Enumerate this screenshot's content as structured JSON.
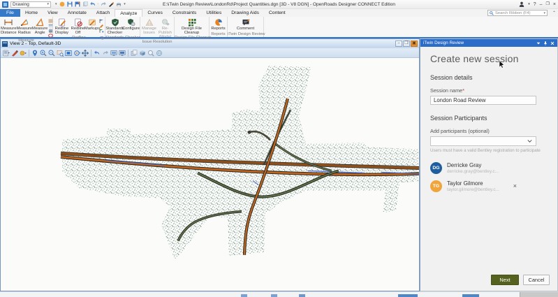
{
  "titlebar": {
    "workflow_label": "Drawing",
    "document_title": "E:\\iTwin Design Review\\LondonRd\\Project Quantities.dgn [3D - V8 DGN] - OpenRoads Designer CONNECT Edition",
    "search_placeholder": "Search Ribbon (F4)"
  },
  "tabs": {
    "file": "File",
    "items": [
      "Home",
      "View",
      "Annotate",
      "Attach",
      "Analyze",
      "Curves",
      "Constraints",
      "Utilities",
      "Drawing Aids",
      "Content"
    ],
    "active": "Analyze"
  },
  "ribbon": {
    "groups": [
      {
        "label": "Measure",
        "buttons": [
          {
            "label": "Measure Distance"
          },
          {
            "label": "Measure Radius"
          },
          {
            "label": "Measure Angle"
          }
        ]
      },
      {
        "label": "Redline",
        "buttons": [
          {
            "label": "Redline Display"
          },
          {
            "label": "Redline Off"
          },
          {
            "label": "Markups"
          }
        ]
      },
      {
        "label": "Standards Checker",
        "buttons": [
          {
            "label": "Standards Checker"
          },
          {
            "label": "Configure"
          }
        ]
      },
      {
        "label": "Issue Resolution",
        "buttons": [
          {
            "label": "Manage Issues"
          },
          {
            "label": "Re-Publish iModel"
          }
        ]
      },
      {
        "label": "Design File Cleanup",
        "buttons": [
          {
            "label": "Design File Cleanup"
          }
        ]
      },
      {
        "label": "Reports",
        "buttons": [
          {
            "label": "Reports"
          }
        ]
      },
      {
        "label": "iTwin Design Review",
        "buttons": [
          {
            "label": "Comment"
          }
        ]
      }
    ]
  },
  "view": {
    "title": "View 2 - Top, Default-3D"
  },
  "panel": {
    "title": "iTwin Design Review",
    "heading": "Create new session",
    "session_details": "Session details",
    "session_name_label": "Session name",
    "required_marker": "*",
    "session_name_value": "London Road Review",
    "participants_heading": "Session Participants",
    "add_participants_label": "Add participants (optional)",
    "helper_text": "Users must have a valid Bentley registration to participate",
    "participants": [
      {
        "initials": "DG",
        "name": "Derricke Gray",
        "email": "derricke.gray@bentley.c...",
        "color": "#1f5e9e"
      },
      {
        "initials": "TG",
        "name": "Taylor Gilmore",
        "email": "taylor.gilmore@bentley.c...",
        "color": "#f0a43c"
      }
    ],
    "remove_label": "×",
    "next_label": "Next",
    "cancel_label": "Cancel"
  },
  "colors": {
    "panel_titlebar_blue": "#2b6cc8",
    "file_tab_blue": "#3579c8",
    "next_button_green": "#55611e",
    "avatar_dg": "#1f5e9e",
    "avatar_tg": "#f0a43c",
    "stipple_green": "#41705f",
    "road_orange": "#c2661f"
  }
}
